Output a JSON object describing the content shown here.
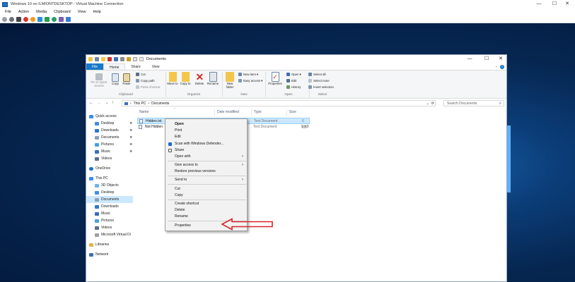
{
  "host": {
    "title": "Windows 10 on ILMIONTDESKTOP - Virtual Machine Connection",
    "menu": [
      "File",
      "Action",
      "Media",
      "Clipboard",
      "View",
      "Help"
    ],
    "window_controls": [
      "—",
      "☐",
      "✕"
    ]
  },
  "explorer": {
    "title": "Documents",
    "window_controls": [
      "—",
      "☐",
      "✕"
    ],
    "tabs": [
      "File",
      "Home",
      "Share",
      "View"
    ],
    "ribbon": {
      "clipboard": {
        "pin_label": "Pin to Quick access",
        "copy": "Copy",
        "paste": "Paste",
        "cut": "Cut",
        "copy_path": "Copy path",
        "paste_shortcut": "Paste shortcut",
        "group": "Clipboard"
      },
      "organize": {
        "move_to": "Move to",
        "copy_to": "Copy to",
        "delete": "Delete",
        "rename": "Rename",
        "group": "Organize"
      },
      "new": {
        "new_folder": "New folder",
        "new_item": "New item",
        "easy_access": "Easy access",
        "group": "New"
      },
      "open": {
        "properties": "Properties",
        "open": "Open",
        "edit": "Edit",
        "history": "History",
        "group": "Open"
      },
      "select": {
        "select_all": "Select all",
        "select_none": "Select none",
        "invert": "Invert selection",
        "group": "Select"
      }
    },
    "address": {
      "crumb1": "This PC",
      "sep": "›",
      "crumb2": "Documents",
      "search_placeholder": "Search Documents"
    },
    "nav": [
      "Quick access",
      "Desktop",
      "Downloads",
      "Documents",
      "Pictures",
      "Music",
      "Videos",
      "OneDrive",
      "This PC",
      "3D Objects",
      "Desktop",
      "Downloads",
      "Documents",
      "Music",
      "Pictures",
      "Videos",
      "Microsoft Virtual Di",
      "Libraries",
      "Network"
    ],
    "columns": [
      "Name",
      "Date modified",
      "Type",
      "Size"
    ],
    "files": [
      {
        "name": "Hidden.txt",
        "type": "Text Document",
        "size": "0 KB"
      },
      {
        "name": "Not Hidden",
        "type": "Text Document",
        "size": "0 KB"
      }
    ]
  },
  "context_menu": {
    "open": "Open",
    "print": "Print",
    "edit": "Edit",
    "scan": "Scan with Windows Defender...",
    "share": "Share",
    "open_with": "Open with",
    "give_access": "Give access to",
    "restore": "Restore previous versions",
    "send_to": "Send to",
    "cut": "Cut",
    "copy": "Copy",
    "create_shortcut": "Create shortcut",
    "delete": "Delete",
    "rename": "Rename",
    "properties": "Properties"
  },
  "colors": {
    "accent": "#1979ca",
    "selection": "#cce8ff",
    "annotation_arrow": "#d9232b"
  }
}
